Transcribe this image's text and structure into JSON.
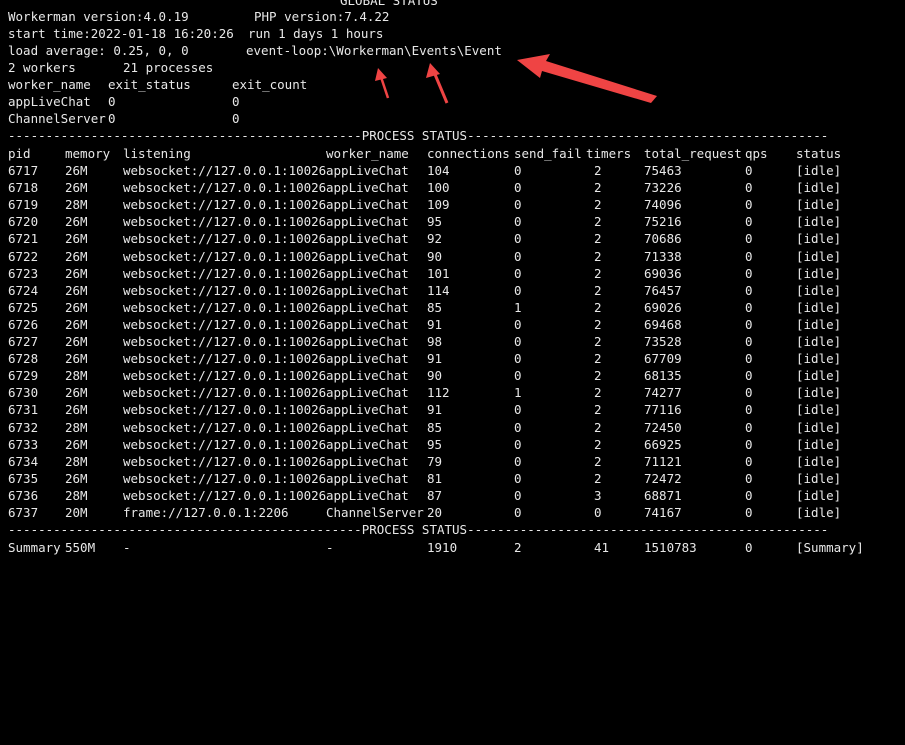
{
  "global": {
    "title_partial": "GLOBAL STATUS",
    "workerman_version": "Workerman version:4.0.19",
    "php_version": "PHP version:7.4.22",
    "start_time": "start time:2022-01-18 16:20:26",
    "run_time": "run 1 days 1 hours",
    "load_average": "load average: 0.25, 0, 0",
    "event_loop": "event-loop:\\Workerman\\Events\\Event",
    "workers": "2 workers",
    "processes": "21 processes"
  },
  "worker_table": {
    "headers": [
      "worker_name",
      "exit_status",
      "exit_count"
    ],
    "rows": [
      [
        "appLiveChat",
        "0",
        "0"
      ],
      [
        "ChannelServer",
        "0",
        "0"
      ]
    ]
  },
  "process_status": {
    "divider_left": "-----------------------------------------------",
    "label": "PROCESS STATUS",
    "divider_right": "------------------------------------------------------",
    "headers": [
      "pid",
      "memory",
      "listening",
      "worker_name",
      "connections",
      "send_fail",
      "timers",
      "total_request",
      "qps",
      "status"
    ],
    "rows": [
      [
        "6717",
        "26M",
        "websocket://127.0.0.1:10026",
        "appLiveChat",
        "104",
        "0",
        "2",
        "75463",
        "0",
        "[idle]"
      ],
      [
        "6718",
        "26M",
        "websocket://127.0.0.1:10026",
        "appLiveChat",
        "100",
        "0",
        "2",
        "73226",
        "0",
        "[idle]"
      ],
      [
        "6719",
        "28M",
        "websocket://127.0.0.1:10026",
        "appLiveChat",
        "109",
        "0",
        "2",
        "74096",
        "0",
        "[idle]"
      ],
      [
        "6720",
        "26M",
        "websocket://127.0.0.1:10026",
        "appLiveChat",
        "95",
        "0",
        "2",
        "75216",
        "0",
        "[idle]"
      ],
      [
        "6721",
        "26M",
        "websocket://127.0.0.1:10026",
        "appLiveChat",
        "92",
        "0",
        "2",
        "70686",
        "0",
        "[idle]"
      ],
      [
        "6722",
        "26M",
        "websocket://127.0.0.1:10026",
        "appLiveChat",
        "90",
        "0",
        "2",
        "71338",
        "0",
        "[idle]"
      ],
      [
        "6723",
        "26M",
        "websocket://127.0.0.1:10026",
        "appLiveChat",
        "101",
        "0",
        "2",
        "69036",
        "0",
        "[idle]"
      ],
      [
        "6724",
        "26M",
        "websocket://127.0.0.1:10026",
        "appLiveChat",
        "114",
        "0",
        "2",
        "76457",
        "0",
        "[idle]"
      ],
      [
        "6725",
        "26M",
        "websocket://127.0.0.1:10026",
        "appLiveChat",
        "85",
        "1",
        "2",
        "69026",
        "0",
        "[idle]"
      ],
      [
        "6726",
        "26M",
        "websocket://127.0.0.1:10026",
        "appLiveChat",
        "91",
        "0",
        "2",
        "69468",
        "0",
        "[idle]"
      ],
      [
        "6727",
        "26M",
        "websocket://127.0.0.1:10026",
        "appLiveChat",
        "98",
        "0",
        "2",
        "73528",
        "0",
        "[idle]"
      ],
      [
        "6728",
        "26M",
        "websocket://127.0.0.1:10026",
        "appLiveChat",
        "91",
        "0",
        "2",
        "67709",
        "0",
        "[idle]"
      ],
      [
        "6729",
        "28M",
        "websocket://127.0.0.1:10026",
        "appLiveChat",
        "90",
        "0",
        "2",
        "68135",
        "0",
        "[idle]"
      ],
      [
        "6730",
        "26M",
        "websocket://127.0.0.1:10026",
        "appLiveChat",
        "112",
        "1",
        "2",
        "74277",
        "0",
        "[idle]"
      ],
      [
        "6731",
        "26M",
        "websocket://127.0.0.1:10026",
        "appLiveChat",
        "91",
        "0",
        "2",
        "77116",
        "0",
        "[idle]"
      ],
      [
        "6732",
        "28M",
        "websocket://127.0.0.1:10026",
        "appLiveChat",
        "85",
        "0",
        "2",
        "72450",
        "0",
        "[idle]"
      ],
      [
        "6733",
        "26M",
        "websocket://127.0.0.1:10026",
        "appLiveChat",
        "95",
        "0",
        "2",
        "66925",
        "0",
        "[idle]"
      ],
      [
        "6734",
        "28M",
        "websocket://127.0.0.1:10026",
        "appLiveChat",
        "79",
        "0",
        "2",
        "71121",
        "0",
        "[idle]"
      ],
      [
        "6735",
        "26M",
        "websocket://127.0.0.1:10026",
        "appLiveChat",
        "81",
        "0",
        "2",
        "72472",
        "0",
        "[idle]"
      ],
      [
        "6736",
        "28M",
        "websocket://127.0.0.1:10026",
        "appLiveChat",
        "87",
        "0",
        "3",
        "68871",
        "0",
        "[idle]"
      ],
      [
        "6737",
        "20M",
        "frame://127.0.0.1:2206",
        "ChannelServer",
        "20",
        "0",
        "0",
        "74167",
        "0",
        "[idle]"
      ]
    ],
    "summary": [
      "Summary",
      "550M",
      "-",
      "-",
      "1910",
      "2",
      "41",
      "1510783",
      "0",
      "[Summary]"
    ]
  },
  "colors": {
    "background": "#000000",
    "text": "#e8e8e8",
    "annotation_arrow": "#ef4444"
  },
  "icons": {
    "annotation": "red-arrow-icon"
  }
}
